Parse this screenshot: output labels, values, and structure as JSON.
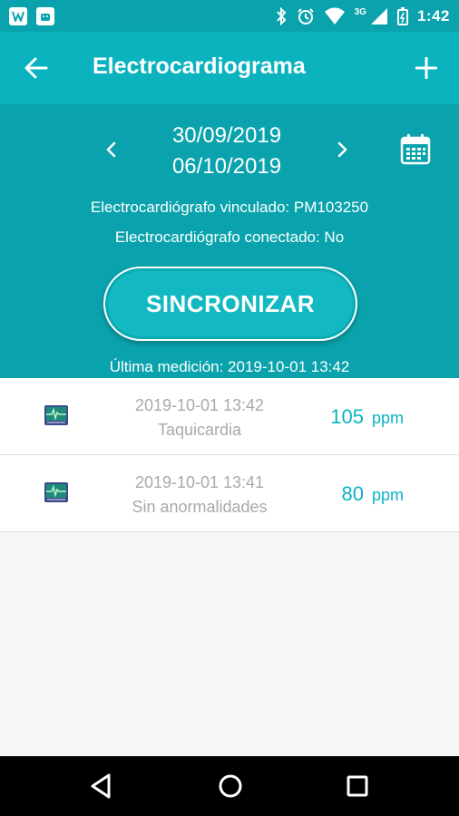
{
  "status_bar": {
    "time": "1:42",
    "network": "3G",
    "icons": [
      "app-w-icon",
      "android-icon",
      "bluetooth-icon",
      "alarm-icon",
      "wifi-icon",
      "signal-icon",
      "battery-icon"
    ]
  },
  "app_bar": {
    "title": "Electrocardiograma",
    "back_icon": "arrow-left-icon",
    "add_icon": "plus-icon"
  },
  "header": {
    "date_start": "30/09/2019",
    "date_end": "06/10/2019",
    "device_linked": "Electrocardiógrafo vinculado: PM103250",
    "device_connected": "Electrocardiógrafo conectado: No",
    "sync_label": "SINCRONIZAR",
    "last_measurement": "Última medición: 2019-10-01 13:42"
  },
  "measurements": [
    {
      "datetime": "2019-10-01 13:42",
      "status": "Taquicardia",
      "value": "105",
      "unit": "ppm"
    },
    {
      "datetime": "2019-10-01 13:41",
      "status": "Sin anormalidades",
      "value": "80",
      "unit": "ppm"
    }
  ],
  "colors": {
    "header_bg": "#0aa3ad",
    "app_bar_bg": "#0bb3bf",
    "accent": "#0bb3c6",
    "muted_text": "#a9a9a9"
  }
}
